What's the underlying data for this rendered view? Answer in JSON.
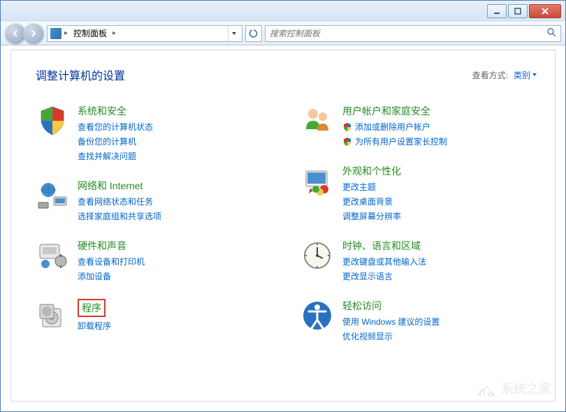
{
  "breadcrumb": {
    "item": "控制面板"
  },
  "search": {
    "placeholder": "搜索控制面板"
  },
  "header": {
    "title": "调整计算机的设置",
    "viewby_label": "查看方式:",
    "viewby_value": "类别"
  },
  "left": [
    {
      "title": "系统和安全",
      "links": [
        {
          "text": "查看您的计算机状态",
          "shield": false
        },
        {
          "text": "备份您的计算机",
          "shield": false
        },
        {
          "text": "查找并解决问题",
          "shield": false
        }
      ]
    },
    {
      "title": "网络和 Internet",
      "links": [
        {
          "text": "查看网络状态和任务",
          "shield": false
        },
        {
          "text": "选择家庭组和共享选项",
          "shield": false
        }
      ]
    },
    {
      "title": "硬件和声音",
      "links": [
        {
          "text": "查看设备和打印机",
          "shield": false
        },
        {
          "text": "添加设备",
          "shield": false
        }
      ]
    },
    {
      "title": "程序",
      "highlighted": true,
      "links": [
        {
          "text": "卸载程序",
          "shield": false
        }
      ]
    }
  ],
  "right": [
    {
      "title": "用户帐户和家庭安全",
      "links": [
        {
          "text": "添加或删除用户帐户",
          "shield": true
        },
        {
          "text": "为所有用户设置家长控制",
          "shield": true
        }
      ]
    },
    {
      "title": "外观和个性化",
      "links": [
        {
          "text": "更改主题",
          "shield": false
        },
        {
          "text": "更改桌面背景",
          "shield": false
        },
        {
          "text": "调整屏幕分辨率",
          "shield": false
        }
      ]
    },
    {
      "title": "时钟、语言和区域",
      "links": [
        {
          "text": "更改键盘或其他输入法",
          "shield": false
        },
        {
          "text": "更改显示语言",
          "shield": false
        }
      ]
    },
    {
      "title": "轻松访问",
      "links": [
        {
          "text": "使用 Windows 建议的设置",
          "shield": false
        },
        {
          "text": "优化视频显示",
          "shield": false
        }
      ]
    }
  ],
  "watermark": "系统之家"
}
